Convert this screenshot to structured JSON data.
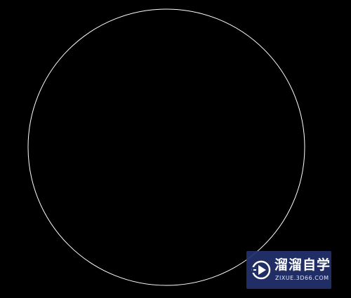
{
  "canvas": {
    "background": "#000000",
    "stroke_color": "#ffffff"
  },
  "entities": [
    {
      "type": "circle",
      "icon": "circle-entity"
    }
  ],
  "watermark": {
    "title": "溜溜自学",
    "url": "ZIXUE.3D66.COM",
    "background": "#23326e",
    "logo": "play-icon"
  }
}
